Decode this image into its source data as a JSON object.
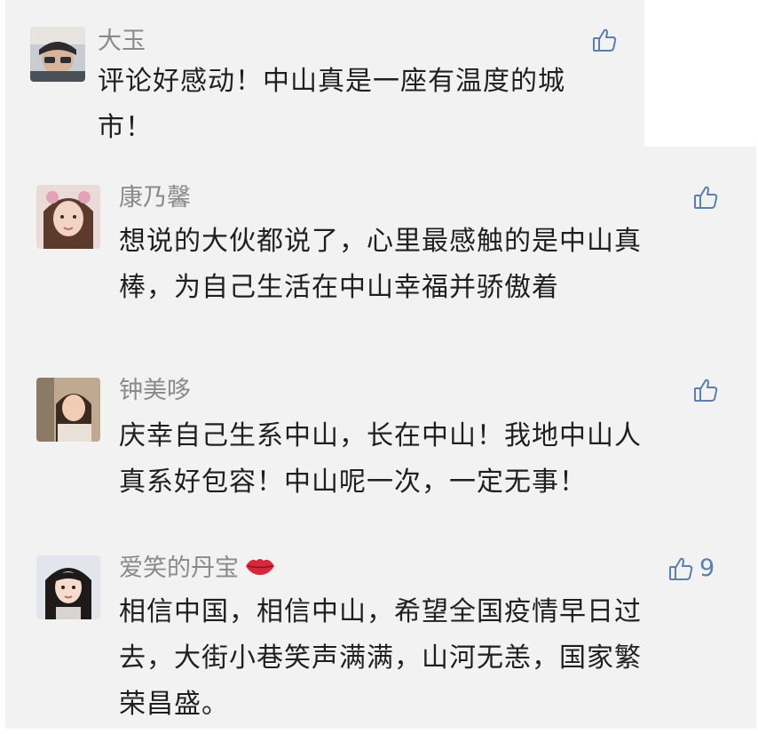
{
  "comments": [
    {
      "name": "大玉",
      "lines": [
        "评论好感动！中山真是一座有温度的城",
        "市！"
      ],
      "like_icon": "thumbs-up-icon",
      "like_count": ""
    },
    {
      "name": "康乃馨",
      "lines": [
        "想说的大伙都说了，心里最感触的是中山真",
        "棒，为自己生活在中山幸福并骄傲着"
      ],
      "like_icon": "thumbs-up-icon",
      "like_count": ""
    },
    {
      "name": "钟美哆",
      "lines": [
        "庆幸自己生系中山，长在中山！我地中山人",
        "真系好包容！中山呢一次，一定无事！"
      ],
      "like_icon": "thumbs-up-icon",
      "like_count": ""
    },
    {
      "name": "爱笑的丹宝",
      "name_emoji_icon": "lips-icon",
      "lines": [
        "相信中国，相信中山，希望全国疫情早日过",
        "去，大街小巷笑声满满，山河无恙，国家繁",
        "荣昌盛。"
      ],
      "like_icon": "thumbs-up-icon",
      "like_count": "9"
    }
  ],
  "colors": {
    "panel_bg": "#f2f2f2",
    "name_gray": "#8a8a8a",
    "like_blue": "#5b7fb0",
    "lips_red": "#d9263b"
  }
}
